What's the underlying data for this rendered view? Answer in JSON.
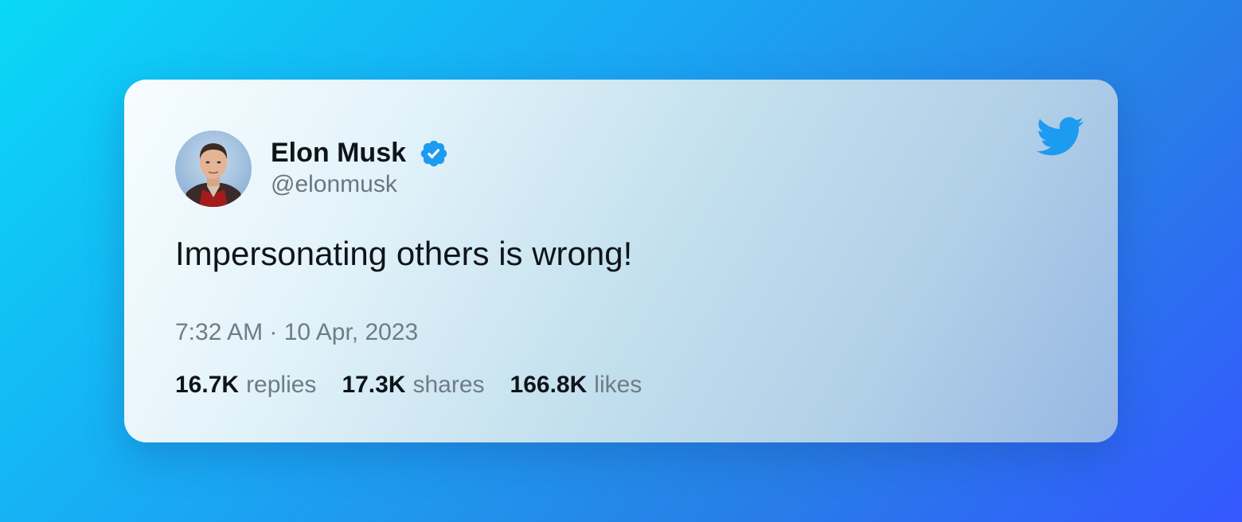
{
  "tweet": {
    "author": {
      "display_name": "Elon Musk",
      "handle": "@elonmusk",
      "verified": true,
      "avatar_icon": "profile-photo"
    },
    "text": "Impersonating others is wrong!",
    "timestamp": "7:32 AM · 10 Apr, 2023",
    "stats": {
      "replies": {
        "value": "16.7K",
        "label": "replies"
      },
      "shares": {
        "value": "17.3K",
        "label": "shares"
      },
      "likes": {
        "value": "166.8K",
        "label": "likes"
      }
    },
    "brand_icon": "twitter-bird-icon"
  },
  "colors": {
    "background_start": "#0ad8f7",
    "background_end": "#3457ff",
    "verified_badge": "#1d9bf0",
    "twitter_blue": "#1d9bf0",
    "primary_text": "#0f1419",
    "secondary_text": "#6e7c86"
  }
}
